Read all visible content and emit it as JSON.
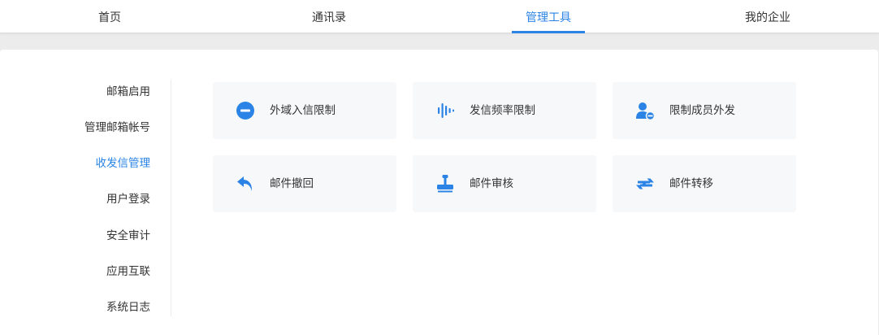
{
  "colors": {
    "accent": "#2b84e5",
    "text": "#333333",
    "card_bg": "#f7f8fa",
    "page_bg": "#ececec"
  },
  "topnav": {
    "items": [
      {
        "label": "首页"
      },
      {
        "label": "通讯录"
      },
      {
        "label": "管理工具",
        "active": true
      },
      {
        "label": "我的企业"
      }
    ]
  },
  "sidebar": {
    "items": [
      {
        "label": "邮箱启用"
      },
      {
        "label": "管理邮箱帐号"
      },
      {
        "label": "收发信管理",
        "active": true
      },
      {
        "label": "用户登录"
      },
      {
        "label": "安全审计"
      },
      {
        "label": "应用互联"
      },
      {
        "label": "系统日志"
      }
    ]
  },
  "tools": [
    {
      "label": "外域入信限制",
      "icon": "minus-circle-icon"
    },
    {
      "label": "发信频率限制",
      "icon": "audio-wave-icon"
    },
    {
      "label": "限制成员外发",
      "icon": "user-restrict-icon"
    },
    {
      "label": "邮件撤回",
      "icon": "undo-arrow-icon"
    },
    {
      "label": "邮件审核",
      "icon": "stamp-icon"
    },
    {
      "label": "邮件转移",
      "icon": "transfer-arrows-icon"
    }
  ]
}
